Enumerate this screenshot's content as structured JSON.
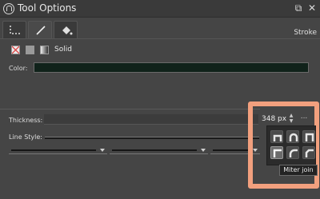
{
  "titlebar": {
    "title": "Tool Options",
    "float_glyph": "⧉",
    "close_glyph": "✕"
  },
  "tabs": [
    {
      "name": "selection-tool",
      "icon": "dotted-corner-icon",
      "active": false
    },
    {
      "name": "line-tool",
      "icon": "line-icon",
      "active": true
    },
    {
      "name": "fill-tool",
      "icon": "paint-bucket-icon",
      "active": false
    }
  ],
  "stroke_label": "Stroke",
  "fill": {
    "solid_label": "Solid",
    "color_label": "Color:",
    "color_value": "#10221a"
  },
  "thickness": {
    "label": "Thickness:",
    "value": "348 px",
    "more_label": "...",
    "spin_up": "▲",
    "spin_down": "▼"
  },
  "line_style": {
    "label": "Line Style:"
  },
  "join_popup": {
    "buttons": [
      "cap-butt-icon",
      "cap-round-icon",
      "cap-square-icon",
      "miter-join-icon",
      "round-join-icon",
      "bevel-join-icon"
    ],
    "selected": "miter-join-icon"
  },
  "tooltip": "Miter join",
  "colors": {
    "highlight": "#f2a07e",
    "panel_bg": "#454545"
  }
}
